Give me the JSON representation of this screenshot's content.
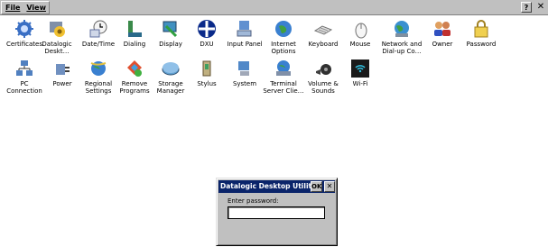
{
  "menu": {
    "file": "File",
    "view": "View"
  },
  "window_buttons": {
    "help": "?",
    "close": "✕"
  },
  "items": [
    {
      "label": "Certificates",
      "icon": "certificates-icon"
    },
    {
      "label": "Datalogic\nDeskt…",
      "icon": "datalogic-desktop-icon"
    },
    {
      "label": "Date/Time",
      "icon": "date-time-icon"
    },
    {
      "label": "Dialing",
      "icon": "dialing-icon"
    },
    {
      "label": "Display",
      "icon": "display-icon"
    },
    {
      "label": "DXU",
      "icon": "dxu-icon"
    },
    {
      "label": "Input Panel",
      "icon": "input-panel-icon"
    },
    {
      "label": "Internet\nOptions",
      "icon": "internet-options-icon"
    },
    {
      "label": "Keyboard",
      "icon": "keyboard-icon"
    },
    {
      "label": "Mouse",
      "icon": "mouse-icon"
    },
    {
      "label": "Network and\nDial-up Co…",
      "icon": "network-icon"
    },
    {
      "label": "Owner",
      "icon": "owner-icon"
    },
    {
      "label": "Password",
      "icon": "password-icon"
    },
    {
      "label": "PC\nConnection",
      "icon": "pc-connection-icon"
    },
    {
      "label": "Power",
      "icon": "power-icon"
    },
    {
      "label": "Regional\nSettings",
      "icon": "regional-settings-icon"
    },
    {
      "label": "Remove\nPrograms",
      "icon": "remove-programs-icon"
    },
    {
      "label": "Storage\nManager",
      "icon": "storage-manager-icon"
    },
    {
      "label": "Stylus",
      "icon": "stylus-icon"
    },
    {
      "label": "System",
      "icon": "system-icon"
    },
    {
      "label": "Terminal\nServer Clie…",
      "icon": "terminal-server-icon"
    },
    {
      "label": "Volume &\nSounds",
      "icon": "volume-sounds-icon"
    },
    {
      "label": "Wi-Fi",
      "icon": "wifi-icon"
    }
  ],
  "dialog": {
    "title": "Datalogic Desktop Utility",
    "ok": "OK",
    "close": "✕",
    "prompt": "Enter password:",
    "password_value": ""
  }
}
